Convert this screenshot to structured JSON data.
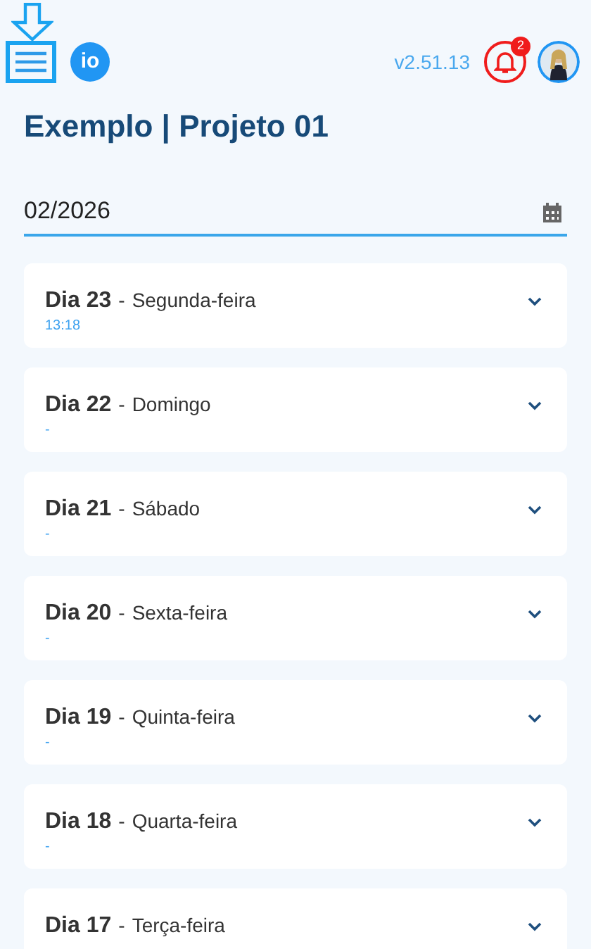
{
  "header": {
    "logo": "io",
    "version": "v2.51.13",
    "notification_count": "2"
  },
  "title": "Exemplo | Projeto 01",
  "month_field": {
    "value": "02/2026"
  },
  "days": [
    {
      "day": "Dia 23",
      "separator": "-",
      "weekday": "Segunda-feira",
      "detail": "13:18",
      "expanded": false
    },
    {
      "day": "Dia 22",
      "separator": "-",
      "weekday": "Domingo",
      "detail": "-",
      "expanded": false
    },
    {
      "day": "Dia 21",
      "separator": "-",
      "weekday": "Sábado",
      "detail": "-",
      "expanded": false
    },
    {
      "day": "Dia 20",
      "separator": "-",
      "weekday": "Sexta-feira",
      "detail": "-",
      "expanded": false
    },
    {
      "day": "Dia 19",
      "separator": "-",
      "weekday": "Quinta-feira",
      "detail": "-",
      "expanded": false
    },
    {
      "day": "Dia 18",
      "separator": "-",
      "weekday": "Quarta-feira",
      "detail": "-",
      "expanded": false
    },
    {
      "day": "Dia 17",
      "separator": "-",
      "weekday": "Terça-feira",
      "expanded": false
    }
  ]
}
